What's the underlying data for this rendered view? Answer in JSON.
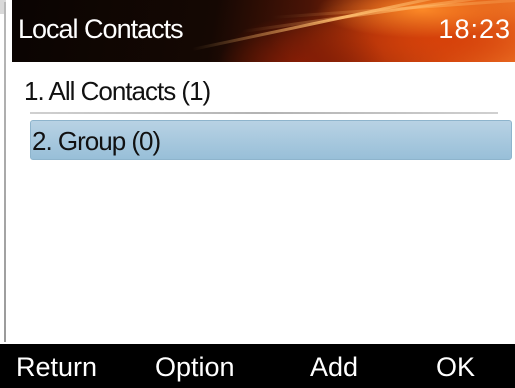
{
  "header": {
    "title": "Local Contacts",
    "time": "18:23"
  },
  "menu": {
    "items": [
      {
        "label": "1. All Contacts (1)",
        "selected": false
      },
      {
        "label": "2. Group (0)",
        "selected": true
      }
    ]
  },
  "softkeys": {
    "return": "Return",
    "option": "Option",
    "add": "Add",
    "ok": "OK"
  },
  "colors": {
    "selection_highlight": "#a8c9de",
    "softkey_bar": "#000000",
    "header_accent": "#d24b10"
  }
}
